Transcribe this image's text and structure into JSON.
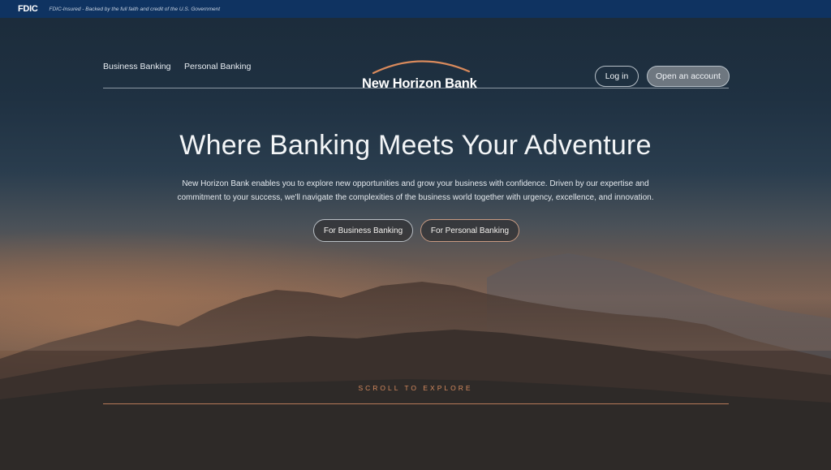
{
  "fdic_bar": {
    "logo": "FDIC",
    "text": "FDIC-Insured - Backed by the full faith and credit of the U.S. Government"
  },
  "nav": {
    "links": [
      "Business Banking",
      "Personal Banking"
    ],
    "brand": "New Horizon Bank",
    "login_label": "Log in",
    "open_account_label": "Open an account"
  },
  "hero": {
    "title": "Where Banking Meets Your Adventure",
    "description": "New Horizon Bank enables you to explore new opportunities and grow your business with confidence. Driven by our expertise and commitment to your success, we'll navigate the complexities of the business world together with urgency, excellence, and innovation.",
    "cta_business": "For Business Banking",
    "cta_personal": "For Personal Banking",
    "scroll_label": "SCROLL TO EXPLORE"
  },
  "colors": {
    "fdic_bar": "#0f3361",
    "accent_orange": "#d58a5e",
    "sky_top": "#1c2c3b"
  }
}
